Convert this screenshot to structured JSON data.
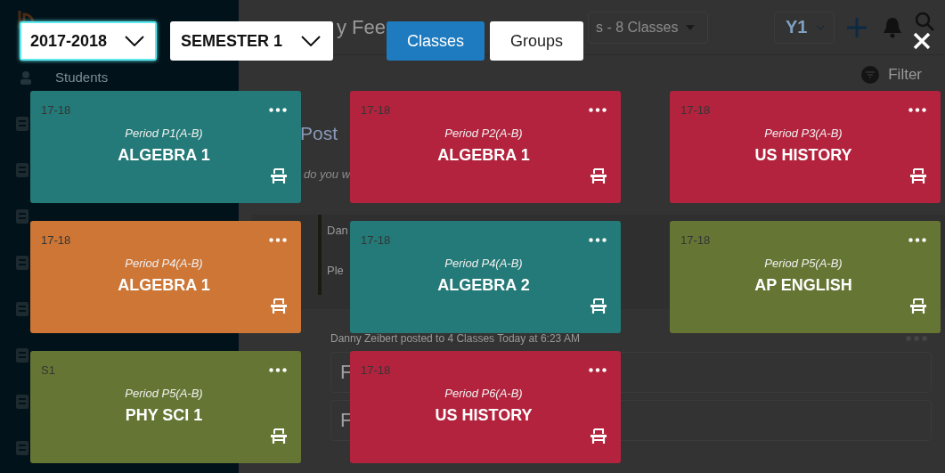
{
  "background": {
    "sidebar": {
      "items": [
        {
          "label": "Students"
        }
      ]
    },
    "header": {
      "title": "y Fee",
      "class_dropdown": "s - 8 Classes",
      "year_dropdown": "Y1"
    },
    "filter": "Filter",
    "post_heading": "Post",
    "post_prompt": "do you w",
    "posts": [
      {
        "author": "Dan",
        "message": "Ple"
      }
    ],
    "post_line": "Danny Zeibert posted to 4 Classes Today at 6:23 AM",
    "reply_fields": [
      {
        "value": "F"
      },
      {
        "value": "F"
      }
    ]
  },
  "picker": {
    "selects": [
      {
        "value": "2017-2018",
        "focused": true
      },
      {
        "value": "SEMESTER 1",
        "focused": false
      }
    ],
    "tabs": [
      {
        "label": "Classes",
        "selected": true
      },
      {
        "label": "Groups",
        "selected": false
      }
    ],
    "classes": [
      {
        "term": "17-18",
        "period": "Period P1(A-B)",
        "name": "ALGEBRA 1",
        "color": "#237a78"
      },
      {
        "term": "17-18",
        "period": "Period P2(A-B)",
        "name": "ALGEBRA 1",
        "color": "#b3233e"
      },
      {
        "term": "17-18",
        "period": "Period P3(A-B)",
        "name": "US HISTORY",
        "color": "#b3233e"
      },
      {
        "term": "17-18",
        "period": "Period P4(A-B)",
        "name": "ALGEBRA 1",
        "color": "#cd7636"
      },
      {
        "term": "17-18",
        "period": "Period P4(A-B)",
        "name": "ALGEBRA 2",
        "color": "#237a78"
      },
      {
        "term": "17-18",
        "period": "Period P5(A-B)",
        "name": "AP ENGLISH",
        "color": "#657634"
      },
      {
        "term": "S1",
        "period": "Period P5(A-B)",
        "name": "PHY SCI 1",
        "color": "#657634"
      },
      {
        "term": "17-18",
        "period": "Period P6(A-B)",
        "name": "US HISTORY",
        "color": "#b3233e"
      }
    ]
  }
}
